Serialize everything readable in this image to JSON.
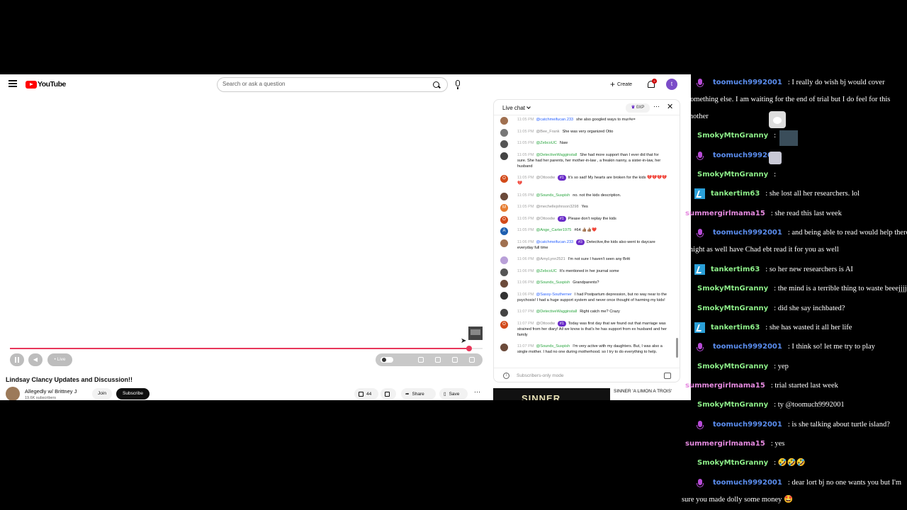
{
  "yt": {
    "logo": "YouTube",
    "search_placeholder": "Search or ask a question",
    "create": "Create",
    "notif_count": "9",
    "user_initial": "t",
    "live": "Live",
    "progress": 0.985,
    "video_title": "Lindsay Clancy Updates and Discussion!!",
    "channel": "Allegedly w/ Brittney J",
    "subs": "19.6K subscribers",
    "join": "Join",
    "subscribe": "Subscribe",
    "likes": "44",
    "share": "Share",
    "save": "Save",
    "rec_thumb_text": "SINNER",
    "rec_title": "SINNER 'A LIMON A TROIS'"
  },
  "chat": {
    "title": "Live chat",
    "xp": "0XP",
    "footer": "Subscribers-only mode",
    "messages": [
      {
        "ts": "11:05 PM",
        "author": "@catchmeifucan.233",
        "color": "b",
        "badge": "",
        "text": "she also googled ways to mur#e=",
        "av": "#a07050",
        "init": ""
      },
      {
        "ts": "11:05 PM",
        "author": "@Bee_Frank",
        "color": "n",
        "badge": "",
        "text": "She was very organized Otto",
        "av": "#777",
        "init": ""
      },
      {
        "ts": "11:05 PM",
        "author": "@ZebcoUC",
        "color": "g",
        "badge": "",
        "text": "Naw",
        "av": "#555",
        "init": ""
      },
      {
        "ts": "11:05 PM",
        "author": "@DetectiveWagginstall",
        "color": "g",
        "badge": "",
        "text": "She had more support than I ever did that for sure. She had her parents, her mother-in-law , a freakin nanny, a sister-in-law, her husband",
        "av": "#444",
        "init": ""
      },
      {
        "ts": "11:05 PM",
        "author": "@Ottoodw",
        "color": "n",
        "badge": "#1",
        "text": "It's so sad! My hearts are broken for the kids 💔💔💔💔💔",
        "av": "#d24a1a",
        "init": "O"
      },
      {
        "ts": "11:05 PM",
        "author": "@Sounds_Suspish",
        "color": "g",
        "badge": "",
        "text": "no. not the kids description.",
        "av": "#6b4a3a",
        "init": ""
      },
      {
        "ts": "11:05 PM",
        "author": "@mechellejohnson3298",
        "color": "n",
        "badge": "",
        "text": "Yes",
        "av": "#e67c30",
        "init": "M"
      },
      {
        "ts": "11:05 PM",
        "author": "@Ottoodw",
        "color": "n",
        "badge": "#1",
        "text": "Please don't replay the kids",
        "av": "#d24a1a",
        "init": "O"
      },
      {
        "ts": "11:05 PM",
        "author": "@Ange_Carter1975",
        "color": "g",
        "badge": "",
        "text": "#64 👍🏽👍🏽❤️",
        "av": "#1e5fb0",
        "init": "A"
      },
      {
        "ts": "11:06 PM",
        "author": "@catchmeifucan.233",
        "color": "b",
        "badge": "#3",
        "text": "Detective,the kids also went to daycare everyday full time",
        "av": "#a07050",
        "init": ""
      },
      {
        "ts": "11:06 PM",
        "author": "@AmyLynn2521",
        "color": "n",
        "badge": "",
        "text": "I'm not sure I haven't seen any Britt",
        "av": "#b9a0d8",
        "init": ""
      },
      {
        "ts": "11:06 PM",
        "author": "@ZebcoUC",
        "color": "g",
        "badge": "",
        "text": "It's mentioned in her journal some",
        "av": "#555",
        "init": ""
      },
      {
        "ts": "11:06 PM",
        "author": "@Sounds_Suspish",
        "color": "g",
        "badge": "",
        "text": "Grandparents?",
        "av": "#6b4a3a",
        "init": ""
      },
      {
        "ts": "11:06 PM",
        "author": "@Sassy-Southerner",
        "color": "b",
        "badge": "",
        "text": "I had Postpartum depression, but no way near to the psychosis! I had a huge support system and never once thought of harming my kids!",
        "av": "#333",
        "init": ""
      },
      {
        "ts": "11:07 PM",
        "author": "@DetectiveWagginstall",
        "color": "g",
        "badge": "",
        "text": "Right catch me? Crazy",
        "av": "#444",
        "init": ""
      },
      {
        "ts": "11:07 PM",
        "author": "@Ottoodw",
        "color": "n",
        "badge": "#1",
        "text": "Today was first day that we found out that marriage was strained from her diary! All we know is that's he has support from ex husband and her family",
        "av": "#d24a1a",
        "init": "O"
      },
      {
        "ts": "11:07 PM",
        "author": "@Sounds_Suspish",
        "color": "g",
        "badge": "",
        "text": "I'm very active with my daughters. But, I was also a single mother. I had no one during motherhood. so I try to do everything to help.",
        "av": "#6b4a3a",
        "init": ""
      }
    ]
  },
  "overlay": [
    {
      "user": "toomuch9992001",
      "cls": "u-blue",
      "badge": "mic",
      "text": ": I really do wish bj would cover",
      "cont": "something else. I am waiting for the end of trial but I do feel for this",
      "cont2": "mother"
    },
    {
      "user": "SmokyMtnGranny",
      "cls": "u-green",
      "badge": "",
      "text": ":"
    },
    {
      "user": "toomuch9992001",
      "cls": "u-blue",
      "badge": "mic",
      "text": ""
    },
    {
      "user": "SmokyMtnGranny",
      "cls": "u-green",
      "badge": "",
      "text": ":"
    },
    {
      "user": "tankertim63",
      "cls": "u-cyan",
      "badge": "bolt",
      "text": ": she lost all her researchers. lol"
    },
    {
      "user": "summergirlmama15",
      "cls": "u-pink",
      "badge": "",
      "text": ": she read this last week"
    },
    {
      "user": "toomuch9992001",
      "cls": "u-blue",
      "badge": "mic",
      "text": ": and being able to read would help there",
      "cont": "might as well have Chad ebt read it for you as well"
    },
    {
      "user": "tankertim63",
      "cls": "u-cyan",
      "badge": "bolt",
      "text": ": so her new researchers is AI"
    },
    {
      "user": "SmokyMtnGranny",
      "cls": "u-green",
      "badge": "",
      "text": ": the mind is a terrible thing to waste beeejjjj"
    },
    {
      "user": "SmokyMtnGranny",
      "cls": "u-green",
      "badge": "",
      "text": ": did she say inchbated?"
    },
    {
      "user": "tankertim63",
      "cls": "u-cyan",
      "badge": "bolt",
      "text": ": she has wasted it all her life"
    },
    {
      "user": "toomuch9992001",
      "cls": "u-blue",
      "badge": "mic",
      "text": ": I think so! let me try to play"
    },
    {
      "user": "SmokyMtnGranny",
      "cls": "u-green",
      "badge": "",
      "text": ": yep"
    },
    {
      "user": "summergirlmama15",
      "cls": "u-pink",
      "badge": "",
      "text": ": trial started last week"
    },
    {
      "user": "SmokyMtnGranny",
      "cls": "u-green",
      "badge": "",
      "text": ": ty @toomuch9992001"
    },
    {
      "user": "toomuch9992001",
      "cls": "u-blue",
      "badge": "mic",
      "text": ": is she talking about turtle island?"
    },
    {
      "user": "summergirlmama15",
      "cls": "u-pink",
      "badge": "",
      "text": ": yes"
    },
    {
      "user": "SmokyMtnGranny",
      "cls": "u-green",
      "badge": "",
      "text": ": 🤣🤣🤣"
    },
    {
      "user": "toomuch9992001",
      "cls": "u-blue",
      "badge": "mic",
      "text": ": dear lort bj no one wants you but I'm",
      "cont": "sure you made dolly some money 🤩"
    }
  ]
}
